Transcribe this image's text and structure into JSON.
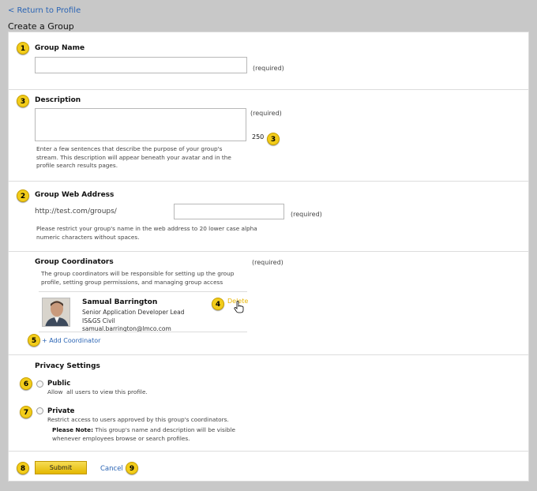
{
  "header": {
    "back_link": "< Return to Profile",
    "title": "Create a Group"
  },
  "group_name": {
    "label": "Group Name",
    "value": "",
    "required": "(required)",
    "badge": "1"
  },
  "description": {
    "label": "Description",
    "value": "",
    "required": "(required)",
    "char_count": "250",
    "badge": "3",
    "count_badge": "3",
    "help_lines": [
      "Enter a few sentences that describe the purpose of your group's",
      "stream. This description will appear beneath your avatar and in the",
      "profile search results pages."
    ]
  },
  "web_address": {
    "label": "Group Web Address",
    "prefix": "http://test.com/groups/",
    "value": "",
    "required": "(required)",
    "badge": "2",
    "help_lines": [
      "Please restrict your group's name in the web address to 20 lower case alpha",
      "numeric characters without spaces."
    ]
  },
  "coordinators": {
    "label": "Group Coordinators",
    "required": "(required)",
    "help_lines": [
      "The group coordinators will be responsible for setting up the group",
      "profile, setting group permissions, and managing group access"
    ],
    "person": {
      "name": "Samual Barrington",
      "title": "Senior Application Developer Lead",
      "department": "IS&GS Civil",
      "email": "samual.barrington@lmco.com"
    },
    "delete_label": "Delete",
    "delete_badge": "4",
    "add_label": "+ Add Coordinator",
    "add_badge": "5"
  },
  "privacy": {
    "label": "Privacy Settings",
    "public": {
      "label": "Public",
      "desc": "Allow  all users to view this profile.",
      "badge": "6"
    },
    "private": {
      "label": "Private",
      "desc": "Restrict access to users approved by this group's coordinators.",
      "badge": "7",
      "note_label": "Please Note:",
      "note_line1": "This group's name and description will be visible",
      "note_line2": "whenever employees browse or search profiles."
    }
  },
  "actions": {
    "submit_label": "Submit",
    "submit_badge": "8",
    "cancel_label": "Cancel",
    "cancel_badge": "9"
  },
  "colors": {
    "badge": "#f2cc1a",
    "link": "#2a64b4",
    "delete_link": "#e8b400",
    "submit": "#e4b800"
  },
  "icons": {
    "cursor": "hand-pointer-icon"
  }
}
